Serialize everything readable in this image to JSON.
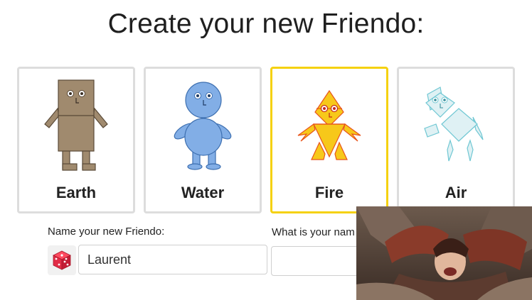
{
  "page": {
    "title": "Create your new Friendo:"
  },
  "elements": [
    {
      "label": "Earth",
      "selected": false,
      "color": "#a08a6e"
    },
    {
      "label": "Water",
      "selected": false,
      "color": "#82aee6"
    },
    {
      "label": "Fire",
      "selected": true,
      "color": "#f7c81a"
    },
    {
      "label": "Air",
      "selected": false,
      "color": "#dff1f4"
    }
  ],
  "form": {
    "name_label": "Name your new Friendo:",
    "name_value": "Laurent",
    "second_label": "What is your nam",
    "second_value": "",
    "dice_icon": "dice-icon"
  },
  "colors": {
    "selected_border": "#f5d10f",
    "card_border": "#dddddd"
  }
}
